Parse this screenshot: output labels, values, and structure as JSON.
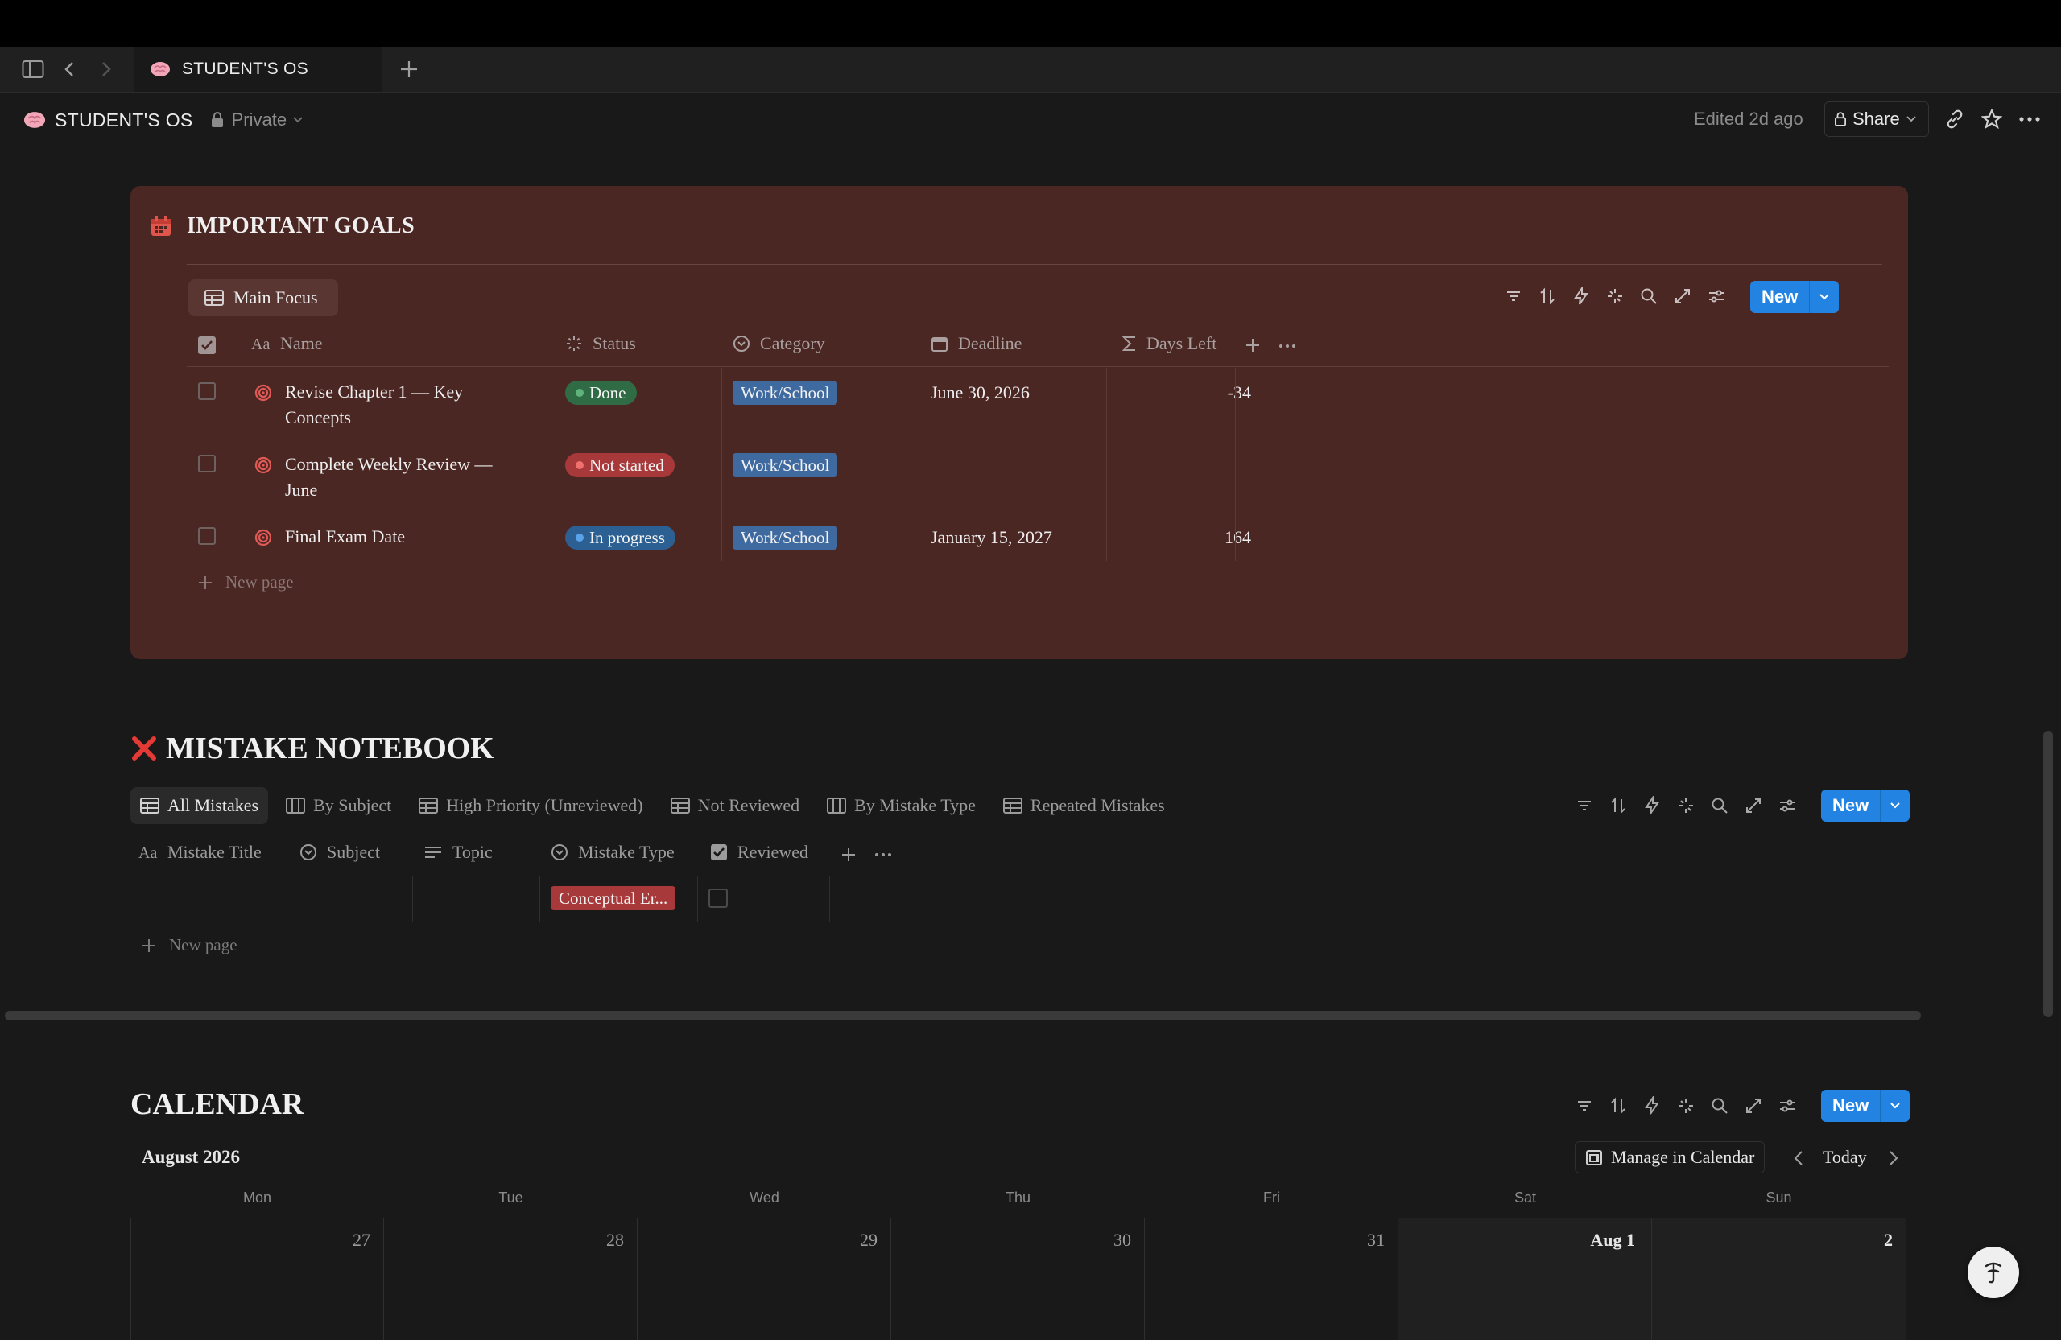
{
  "tab": {
    "title": "STUDENT'S OS"
  },
  "breadcrumb": {
    "title": "STUDENT'S OS",
    "privacy": "Private"
  },
  "header_right": {
    "edited": "Edited 2d ago",
    "share": "Share"
  },
  "goals": {
    "title": "IMPORTANT GOALS",
    "view": "Main Focus",
    "new_label": "New",
    "columns": [
      "Name",
      "Status",
      "Category",
      "Deadline",
      "Days Left"
    ],
    "rows": [
      {
        "name_line1": "Revise Chapter 1 — Key",
        "name_line2": "Concepts",
        "status": "Done",
        "category": "Work/School",
        "deadline": "June 30, 2026",
        "days_left": "-34"
      },
      {
        "name_line1": "Complete Weekly Review —",
        "name_line2": "June",
        "status": "Not started",
        "category": "Work/School",
        "deadline": "",
        "days_left": ""
      },
      {
        "name_line1": "Final Exam Date",
        "name_line2": "",
        "status": "In progress",
        "category": "Work/School",
        "deadline": "January 15, 2027",
        "days_left": "164"
      }
    ],
    "new_page": "New page",
    "colors": {
      "done": "#2f6c45",
      "not_started": "#a8393a",
      "in_progress": "#2c5f92",
      "category": "#3f6aa0",
      "card": "#4b2724"
    }
  },
  "mistakes": {
    "title": "MISTAKE NOTEBOOK",
    "views": [
      "All Mistakes",
      "By Subject",
      "High Priority (Unreviewed)",
      "Not Reviewed",
      "By Mistake Type",
      "Repeated Mistakes"
    ],
    "new_label": "New",
    "columns": [
      "Mistake Title",
      "Subject",
      "Topic",
      "Mistake Type",
      "Reviewed"
    ],
    "rows": [
      {
        "title": "",
        "subject": "",
        "topic": "",
        "mistake_type": "Conceptual Er...",
        "reviewed": false
      }
    ],
    "new_page": "New page"
  },
  "calendar": {
    "title": "CALENDAR",
    "month": "August 2026",
    "manage": "Manage in Calendar",
    "today": "Today",
    "new_label": "New",
    "weekdays": [
      "Mon",
      "Tue",
      "Wed",
      "Thu",
      "Fri",
      "Sat",
      "Sun"
    ],
    "days": [
      "27",
      "28",
      "29",
      "30",
      "31",
      "Aug 1",
      "2"
    ]
  }
}
